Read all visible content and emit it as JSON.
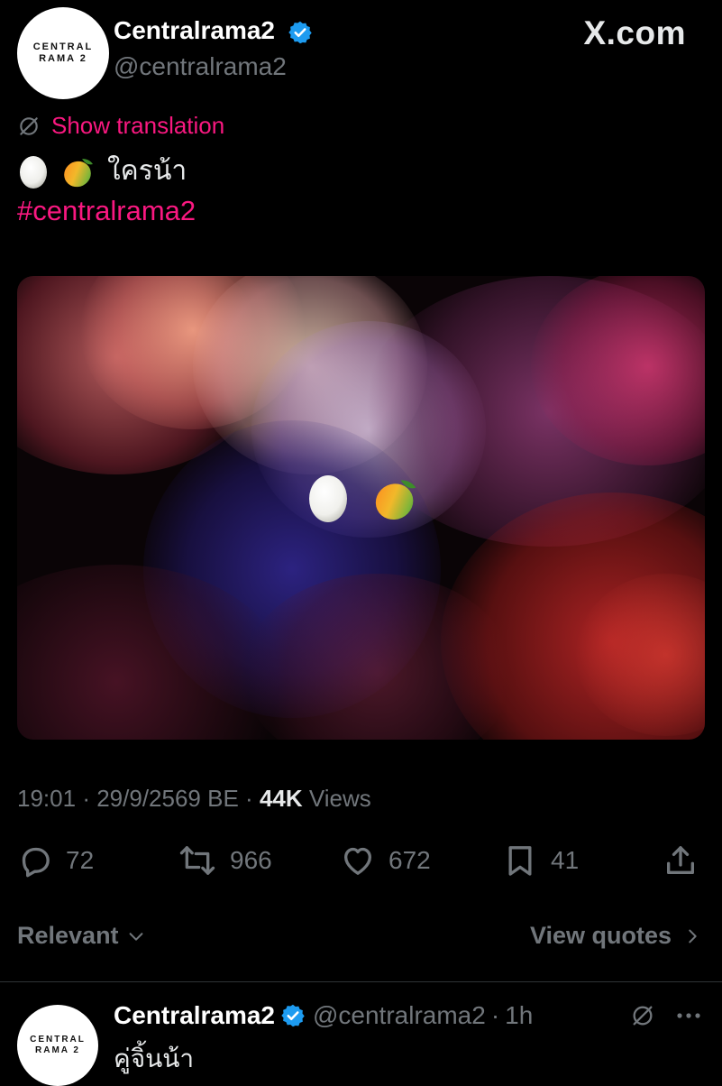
{
  "header": {
    "avatar_line1": "CENTRAL",
    "avatar_line2": "RAMA 2",
    "display_name": "Centralrama2",
    "handle": "@centralrama2",
    "site_logo": "X.com"
  },
  "tweet": {
    "translate_label": "Show translation",
    "text": "ใครน้า",
    "emojis": [
      "🥚",
      "🥭"
    ],
    "hashtag": "#centralrama2",
    "time": "19:01",
    "date": "29/9/2569 BE",
    "views_count": "44K",
    "views_label": "Views",
    "sep": "·"
  },
  "actions": {
    "replies": "72",
    "reposts": "966",
    "likes": "672",
    "bookmarks": "41"
  },
  "sort": {
    "left_label": "Relevant",
    "right_label": "View quotes"
  },
  "reply": {
    "avatar_line1": "CENTRAL",
    "avatar_line2": "RAMA 2",
    "display_name": "Centralrama2",
    "handle": "@centralrama2",
    "sep": "·",
    "age": "1h",
    "text": "คู่จิ้นน้า"
  },
  "colors": {
    "accent": "#f91880",
    "verified": "#1d9bf0",
    "muted": "#71767b",
    "text": "#e7e9ea",
    "background": "#000000"
  }
}
